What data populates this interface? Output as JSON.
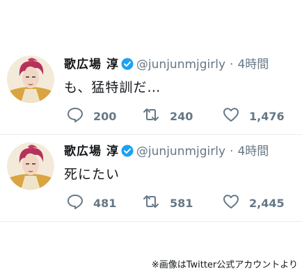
{
  "colors": {
    "verified": "#1da1f2",
    "muted": "#657786",
    "text": "#14171a",
    "divider": "#e6ecf0"
  },
  "tweets": [
    {
      "name": "歌広場 淳",
      "handle": "@junjunmjgirly",
      "separator": "·",
      "time": "4時間",
      "text": "も、猛特訓だ…",
      "replies": "200",
      "retweets": "240",
      "likes": "1,476"
    },
    {
      "name": "歌広場 淳",
      "handle": "@junjunmjgirly",
      "separator": "·",
      "time": "4時間",
      "text": "死にたい",
      "replies": "481",
      "retweets": "581",
      "likes": "2,445"
    }
  ],
  "icons": [
    "verified-badge-icon",
    "reply-icon",
    "retweet-icon",
    "like-icon"
  ],
  "caption": "※画像はTwitter公式アカウントより"
}
